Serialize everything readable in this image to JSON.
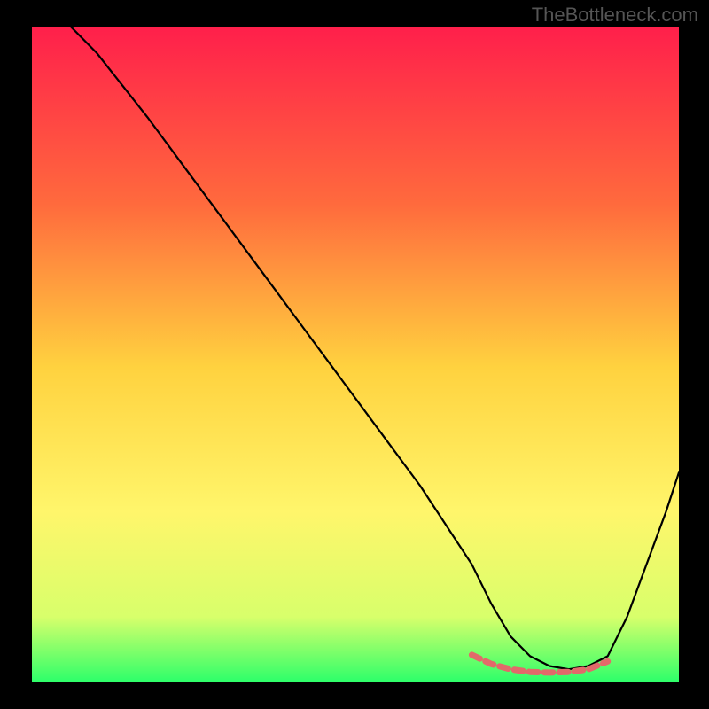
{
  "watermark": "TheBottleneck.com",
  "chart_data": {
    "type": "line",
    "title": "",
    "xlabel": "",
    "ylabel": "",
    "xlim": [
      0,
      100
    ],
    "ylim": [
      0,
      100
    ],
    "gradient_stops": [
      {
        "offset": 0,
        "color": "#ff1f4b"
      },
      {
        "offset": 27,
        "color": "#ff6a3d"
      },
      {
        "offset": 52,
        "color": "#ffd23f"
      },
      {
        "offset": 74,
        "color": "#fff66b"
      },
      {
        "offset": 90,
        "color": "#d8ff6b"
      },
      {
        "offset": 100,
        "color": "#2cff6a"
      }
    ],
    "series": [
      {
        "name": "curve",
        "color": "#000000",
        "stroke_width": 2.2,
        "x": [
          6,
          10,
          14,
          18,
          24,
          30,
          36,
          42,
          48,
          54,
          60,
          64,
          68,
          71,
          74,
          77,
          80,
          83,
          86,
          89,
          92,
          95,
          98,
          100
        ],
        "y": [
          100,
          96,
          91,
          86,
          78,
          70,
          62,
          54,
          46,
          38,
          30,
          24,
          18,
          12,
          7,
          4,
          2.5,
          2,
          2.5,
          4,
          10,
          18,
          26,
          32
        ]
      },
      {
        "name": "highlight",
        "color": "#e26a6a",
        "stroke_width": 7,
        "dash": "10 7",
        "x": [
          68,
          71,
          74,
          77,
          80,
          83,
          86,
          89
        ],
        "y": [
          4.2,
          2.8,
          2.0,
          1.6,
          1.5,
          1.6,
          2.0,
          3.2
        ]
      }
    ]
  }
}
